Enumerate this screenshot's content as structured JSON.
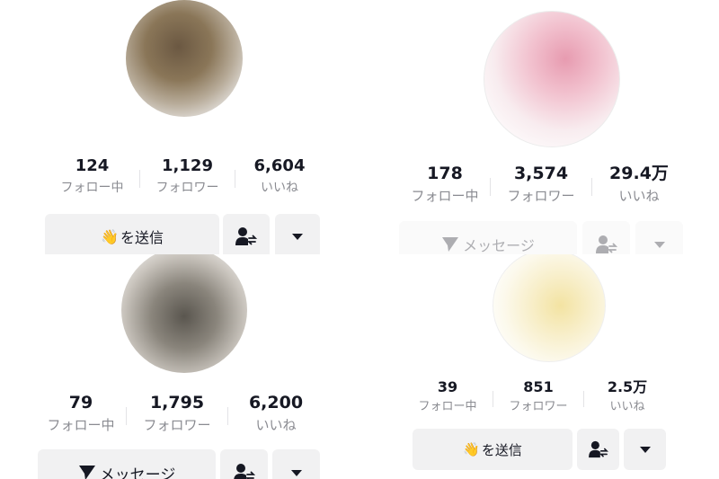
{
  "profiles": [
    {
      "following": "124",
      "following_label": "フォロー中",
      "followers": "1,129",
      "followers_label": "フォロワー",
      "likes": "6,604",
      "likes_label": "いいね",
      "action_label": "を送信",
      "action_icon": "waving-hand-icon"
    },
    {
      "following": "178",
      "following_label": "フォロー中",
      "followers": "3,574",
      "followers_label": "フォロワー",
      "likes": "29.4万",
      "likes_label": "いいね",
      "action_label": "メッセージ",
      "action_icon": "send-arrow-icon"
    },
    {
      "following": "79",
      "following_label": "フォロー中",
      "followers": "1,795",
      "followers_label": "フォロワー",
      "likes": "6,200",
      "likes_label": "いいね",
      "action_label": "メッセージ",
      "action_icon": "send-arrow-icon"
    },
    {
      "following": "39",
      "following_label": "フォロー中",
      "followers": "851",
      "followers_label": "フォロワー",
      "likes": "2.5万",
      "likes_label": "いいね",
      "action_label": "を送信",
      "action_icon": "waving-hand-icon"
    }
  ],
  "colors": {
    "button_bg": "#f1f1f2",
    "label_gray": "#8a8b91",
    "text_dark": "#161823"
  }
}
